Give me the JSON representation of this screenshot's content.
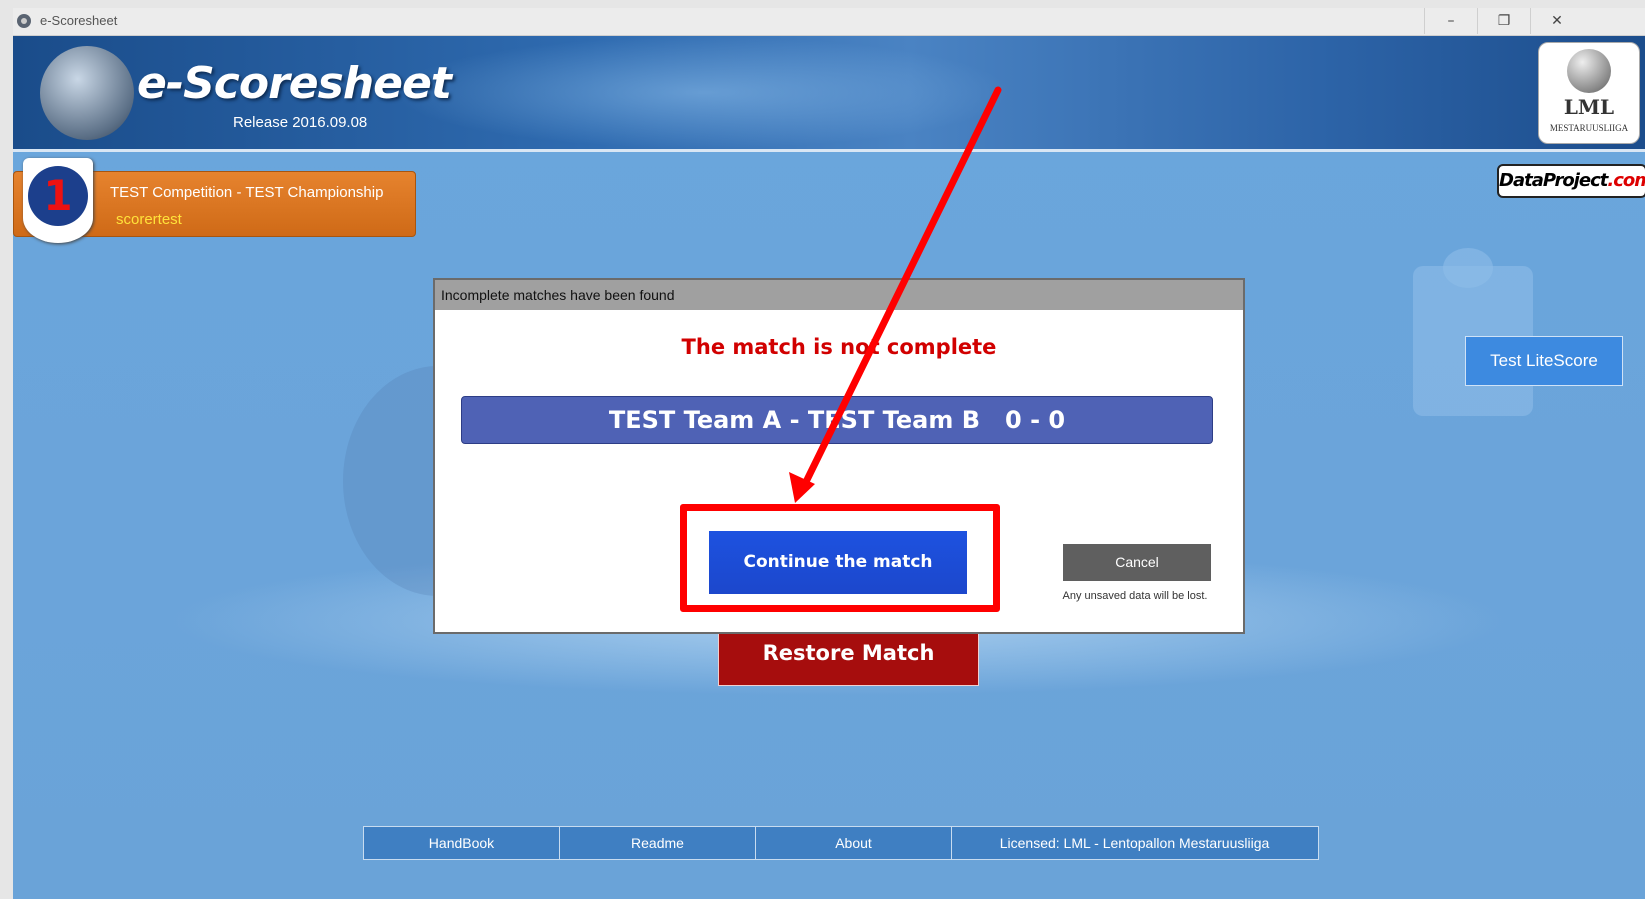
{
  "window": {
    "title": "e-Scoresheet",
    "minimize": "–",
    "restore": "❐",
    "close": "✕"
  },
  "banner": {
    "app_name": "e-Scoresheet",
    "release": "Release 2016.09.08",
    "lml_logo_text": "LML",
    "lml_logo_sub": "MESTARUUSLIIGA",
    "dataproject_prefix": "DataProject",
    "dataproject_suffix": ".com"
  },
  "competition": {
    "badge": "1",
    "title": "TEST Competition - TEST Championship",
    "user": "scorertest"
  },
  "test_litescore_label": "Test LiteScore",
  "restore_label": "Restore Match",
  "footer": {
    "items": [
      "HandBook",
      "Readme",
      "About",
      "Licensed: LML - Lentopallon Mestaruusliiga"
    ]
  },
  "dialog": {
    "title": "Incomplete matches have been found",
    "heading": "The match is not complete",
    "match_line": "TEST Team A - TEST Team B   0 - 0",
    "continue_label": "Continue the match",
    "cancel_label": "Cancel",
    "cancel_note": "Any unsaved data will be lost."
  },
  "colors": {
    "highlight": "#ff0000",
    "continue": "#1d52e0",
    "restore": "#a60d0d",
    "match_bar": "#4f62b5"
  }
}
